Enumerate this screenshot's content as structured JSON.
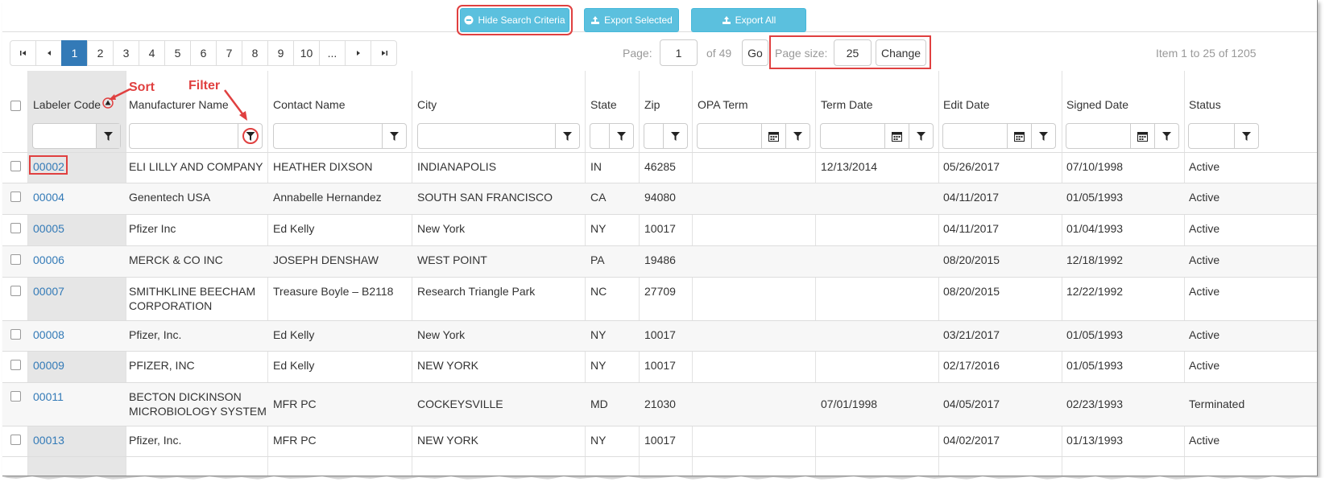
{
  "toolbar": {
    "hide_search": "Hide Search Criteria",
    "export_selected": "Export Selected",
    "export_all": "Export All"
  },
  "pager": {
    "pages": [
      "1",
      "2",
      "3",
      "4",
      "5",
      "6",
      "7",
      "8",
      "9",
      "10",
      "..."
    ],
    "active_page": "1",
    "page_label": "Page:",
    "page_value": "1",
    "of_label": "of 49",
    "go_label": "Go",
    "page_size_label": "Page size:",
    "page_size_value": "25",
    "change_label": "Change",
    "item_info": "Item 1 to 25 of 1205"
  },
  "annotations": {
    "sort": "Sort",
    "filter": "Filter"
  },
  "columns": [
    "Labeler Code",
    "Manufacturer Name",
    "Contact Name",
    "City",
    "State",
    "Zip",
    "OPA Term",
    "Term Date",
    "Edit Date",
    "Signed Date",
    "Status"
  ],
  "rows": [
    {
      "code": "00002",
      "mfr": [
        "ELI LILLY AND COMPANY"
      ],
      "contact": "HEATHER DIXSON",
      "city": "INDIANAPOLIS",
      "state": "IN",
      "zip": "46285",
      "opa": "",
      "term": "12/13/2014",
      "edit": "05/26/2017",
      "signed": "07/10/1998",
      "status": "Active"
    },
    {
      "code": "00004",
      "mfr": [
        "Genentech USA"
      ],
      "contact": "Annabelle Hernandez",
      "city": "SOUTH SAN FRANCISCO",
      "state": "CA",
      "zip": "94080",
      "opa": "",
      "term": "",
      "edit": "04/11/2017",
      "signed": "01/05/1993",
      "status": "Active"
    },
    {
      "code": "00005",
      "mfr": [
        "Pfizer Inc"
      ],
      "contact": "Ed Kelly",
      "city": "New York",
      "state": "NY",
      "zip": "10017",
      "opa": "",
      "term": "",
      "edit": "04/11/2017",
      "signed": "01/04/1993",
      "status": "Active"
    },
    {
      "code": "00006",
      "mfr": [
        "MERCK & CO INC"
      ],
      "contact": "JOSEPH DENSHAW",
      "city": "WEST POINT",
      "state": "PA",
      "zip": "19486",
      "opa": "",
      "term": "",
      "edit": "08/20/2015",
      "signed": "12/18/1992",
      "status": "Active"
    },
    {
      "code": "00007",
      "mfr": [
        "SMITHKLINE BEECHAM",
        "CORPORATION"
      ],
      "contact": "Treasure Boyle – B2118",
      "city": "Research Triangle Park",
      "state": "NC",
      "zip": "27709",
      "opa": "",
      "term": "",
      "edit": "08/20/2015",
      "signed": "12/22/1992",
      "status": "Active"
    },
    {
      "code": "00008",
      "mfr": [
        "Pfizer, Inc."
      ],
      "contact": "Ed Kelly",
      "city": "New York",
      "state": "NY",
      "zip": "10017",
      "opa": "",
      "term": "",
      "edit": "03/21/2017",
      "signed": "01/05/1993",
      "status": "Active"
    },
    {
      "code": "00009",
      "mfr": [
        "PFIZER, INC"
      ],
      "contact": "Ed Kelly",
      "city": "NEW YORK",
      "state": "NY",
      "zip": "10017",
      "opa": "",
      "term": "",
      "edit": "02/17/2016",
      "signed": "01/05/1993",
      "status": "Active"
    },
    {
      "code": "00011",
      "mfr": [
        "BECTON DICKINSON",
        "MICROBIOLOGY SYSTEM"
      ],
      "contact": "MFR PC",
      "city": "COCKEYSVILLE",
      "state": "MD",
      "zip": "21030",
      "opa": "",
      "term": "07/01/1998",
      "edit": "04/05/2017",
      "signed": "02/23/1993",
      "status": "Terminated"
    },
    {
      "code": "00013",
      "mfr": [
        "Pfizer, Inc."
      ],
      "contact": "MFR PC",
      "city": "NEW YORK",
      "state": "NY",
      "zip": "10017",
      "opa": "",
      "term": "",
      "edit": "04/02/2017",
      "signed": "01/13/1993",
      "status": "Active"
    }
  ],
  "colors": {
    "accent": "#5bc0de",
    "pager_active": "#337ab7",
    "link": "#337ab7",
    "annotation": "#e04040"
  }
}
